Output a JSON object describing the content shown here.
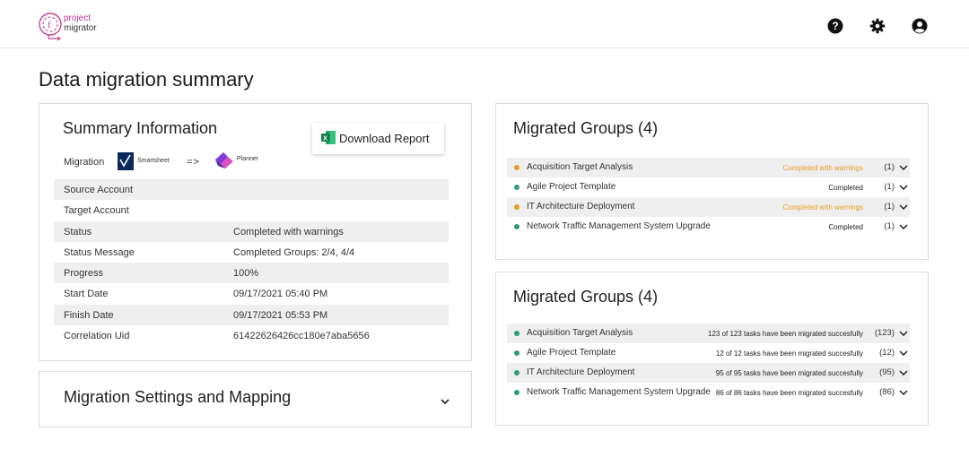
{
  "app": {
    "logo_line1": "project",
    "logo_line2": "migrator"
  },
  "page_title": "Data migration summary",
  "summary": {
    "title": "Summary Information",
    "migration_label": "Migration",
    "source_tool": "Smartsheet",
    "arrow": "=>",
    "target_tool": "Planner",
    "download_label": "Download Report",
    "rows": [
      {
        "key": "Source Account",
        "value": ""
      },
      {
        "key": "Target Account",
        "value": ""
      },
      {
        "key": "Status",
        "value": "Completed with warnings"
      },
      {
        "key": "Status Message",
        "value": "Completed Groups: 2/4, 4/4"
      },
      {
        "key": "Progress",
        "value": "100%"
      },
      {
        "key": "Start Date",
        "value": "09/17/2021 05:40 PM"
      },
      {
        "key": "Finish Date",
        "value": "09/17/2021 05:53 PM"
      },
      {
        "key": "Correlation Uid",
        "value": "61422626426cc180e7aba5656"
      }
    ]
  },
  "settings": {
    "title": "Migration Settings and Mapping"
  },
  "groups_status": {
    "title": "Migrated Groups (4)",
    "rows": [
      {
        "name": "Acquisition Target Analysis",
        "status": "Completed with warnings",
        "count": "(1)",
        "warn": true
      },
      {
        "name": "Agile Project Template",
        "status": "Completed",
        "count": "(1)",
        "warn": false
      },
      {
        "name": "IT Architecture Deployment",
        "status": "Completed with warnings",
        "count": "(1)",
        "warn": true
      },
      {
        "name": "Network Traffic Management System Upgrade",
        "status": "Completed",
        "count": "(1)",
        "warn": false
      }
    ]
  },
  "groups_tasks": {
    "title": "Migrated Groups (4)",
    "rows": [
      {
        "name": "Acquisition Target Analysis",
        "status": "123 of 123 tasks have been migrated succesfully",
        "count": "(123)"
      },
      {
        "name": "Agile Project Template",
        "status": "12 of 12 tasks have been migrated succesfully",
        "count": "(12)"
      },
      {
        "name": "IT Architecture Deployment",
        "status": "95 of 95 tasks have been migrated succesfully",
        "count": "(95)"
      },
      {
        "name": "Network Traffic Management System Upgrade",
        "status": "86 of 86 tasks have been migrated succesfully",
        "count": "(86)"
      }
    ]
  },
  "colors": {
    "warning": "#e49e23",
    "success": "#2e9e6e",
    "brand": "#b5338a"
  },
  "icons": [
    "help-icon",
    "settings-icon",
    "account-icon",
    "chevron-down-icon"
  ]
}
